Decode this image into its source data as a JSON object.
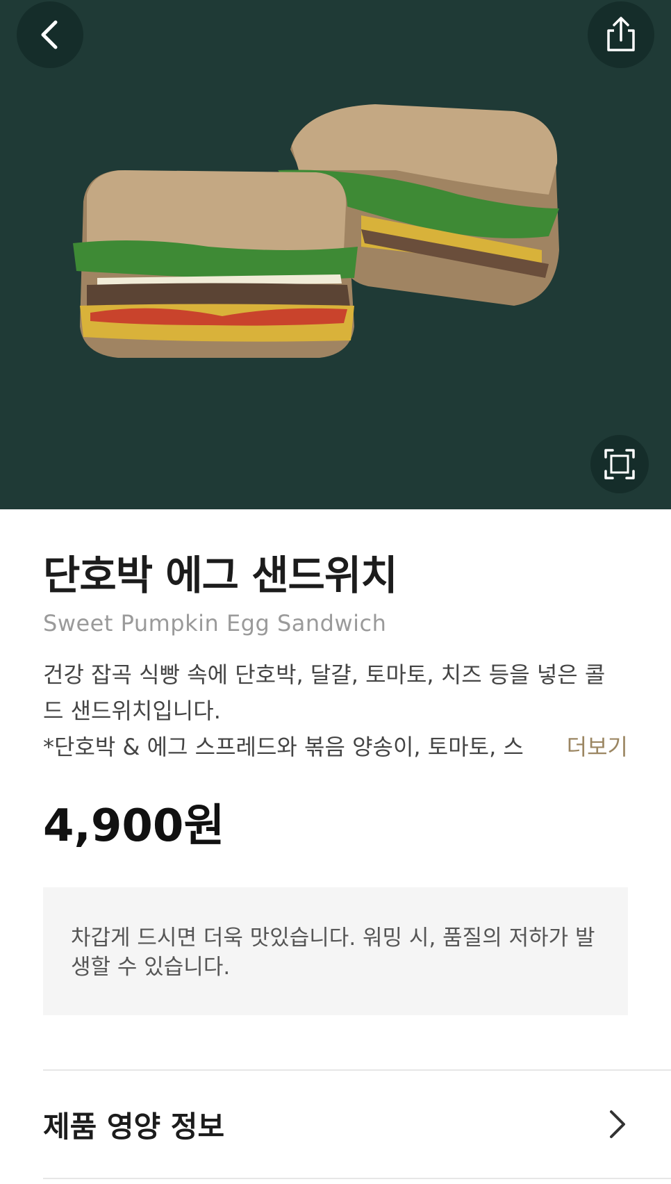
{
  "product": {
    "name_ko": "단호박 에그 샌드위치",
    "name_en": "Sweet Pumpkin Egg Sandwich",
    "description_line1": "건강 잡곡 식빵 속에 단호박, 달걀, 토마토, 치즈 등을 넣은 콜",
    "description_line2": "드 샌드위치입니다.",
    "description_line3": "*단호박 & 에그 스프레드와 볶음 양송이, 토마토, 스",
    "more_label": "더보기",
    "price": "4,900원",
    "notice": "차갑게 드시면 더욱 맛있습니다. 워밍 시, 품질의 저하가 발생할 수 있습니다."
  },
  "nutrition": {
    "label": "제품 영양 정보"
  },
  "icons": {
    "back": "chevron-left-icon",
    "share": "share-icon",
    "expand": "expand-icon",
    "nutrition_arrow": "chevron-right-icon"
  },
  "colors": {
    "hero_background": "#1f3a36",
    "more_link": "#9b8662",
    "notice_background": "#f5f5f5"
  }
}
